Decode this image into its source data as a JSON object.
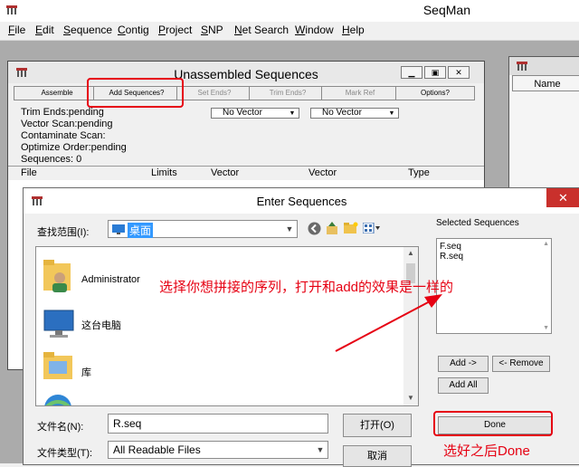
{
  "app": {
    "title": "SeqMan",
    "menu": [
      {
        "u": "F",
        "rest": "ile"
      },
      {
        "u": "E",
        "rest": "dit"
      },
      {
        "u": "S",
        "rest": "equence"
      },
      {
        "u": "C",
        "rest": "ontig"
      },
      {
        "u": "P",
        "rest": "roject"
      },
      {
        "u": "S",
        "rest": "NP"
      },
      {
        "u": "N",
        "rest": "et Search"
      },
      {
        "u": "W",
        "rest": "indow"
      },
      {
        "u": "H",
        "rest": "elp"
      }
    ]
  },
  "right_window": {
    "column_header": "Name"
  },
  "unassembled": {
    "title": "Unassembled Sequences",
    "toolbar": {
      "assemble": "Assemble",
      "add_sequences": "Add Sequences?",
      "set_ends": "Set Ends?",
      "trim_ends": "Trim Ends?",
      "mark_ref": "Mark Ref",
      "options": "Options?"
    },
    "status": {
      "trim_ends": "Trim Ends:pending",
      "vector_scan": "Vector Scan:pending",
      "contaminate_scan": "Contaminate Scan:",
      "optimize_order": "Optimize Order:pending",
      "sequences": "Sequences: 0"
    },
    "vector1": "No Vector",
    "vector2": "No Vector",
    "columns": [
      "File",
      "Limits",
      "Vector",
      "Vector",
      "Type"
    ]
  },
  "dialog": {
    "title": "Enter Sequences",
    "close_glyph": "✕",
    "look_in_label": "查找范围(I):",
    "look_in_value": "桌面",
    "items": [
      "Administrator",
      "这台电脑",
      "库"
    ],
    "filename_label": "文件名(N):",
    "filename_value": "R.seq",
    "filetype_label": "文件类型(T):",
    "filetype_value": "All Readable Files",
    "open_button": "打开(O)",
    "cancel_button": "取消",
    "selected_label": "Selected Sequences",
    "selected_items": [
      "F.seq",
      "R.seq"
    ],
    "add_button": "Add ->",
    "remove_button": "<- Remove",
    "add_all_button": "Add All",
    "done_button": "Done"
  },
  "annotations": {
    "middle": "选择你想拼接的序列，打开和add的效果是一样的",
    "done": "选好之后Done"
  },
  "colors": {
    "annotation_red": "#e60012",
    "titlebar_close": "#c9302c"
  }
}
